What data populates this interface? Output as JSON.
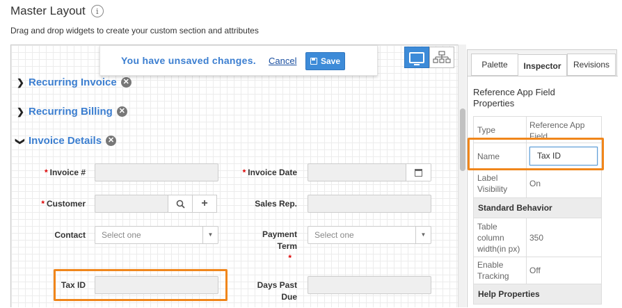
{
  "header": {
    "title": "Master Layout",
    "info_icon": "info-icon",
    "subtitle": "Drag and drop widgets to create your custom section and attributes"
  },
  "unsaved": {
    "message": "You have unsaved changes.",
    "cancel_label": "Cancel",
    "save_label": "Save"
  },
  "view_toggle": {
    "desktop_icon": "monitor-icon",
    "tree_icon": "sitemap-icon"
  },
  "sections": [
    {
      "label": "Recurring Invoice",
      "expanded": false
    },
    {
      "label": "Recurring Billing",
      "expanded": false
    },
    {
      "label": "Invoice Details",
      "expanded": true
    }
  ],
  "form": {
    "invoice_no": {
      "label": "Invoice #",
      "required": true
    },
    "invoice_date": {
      "label": "Invoice Date",
      "required": true
    },
    "customer": {
      "label": "Customer",
      "required": true
    },
    "sales_rep": {
      "label": "Sales Rep.",
      "required": false
    },
    "contact": {
      "label": "Contact",
      "required": false,
      "placeholder": "Select one"
    },
    "payment_term": {
      "label_line1": "Payment",
      "label_line2": "Term",
      "required": true,
      "placeholder": "Select one"
    },
    "tax_id": {
      "label": "Tax ID",
      "required": false
    },
    "days_past_due": {
      "label_line1": "Days Past",
      "label_line2": "Due",
      "required": false
    }
  },
  "panel": {
    "tabs": [
      "Palette",
      "Inspector",
      "Revisions"
    ],
    "active_tab": "Inspector",
    "title": "Reference App Field Properties",
    "rows": [
      {
        "key": "Type",
        "value": "Reference App Field"
      },
      {
        "key": "Name",
        "value": "Tax ID"
      },
      {
        "key": "Label Visibility",
        "value": "On"
      }
    ],
    "standard_behavior": "Standard Behavior",
    "behavior_rows": [
      {
        "key": "Table column width(in px)",
        "value": "350"
      },
      {
        "key": "Enable Tracking",
        "value": "Off"
      }
    ],
    "help_properties": "Help Properties"
  },
  "colors": {
    "accent": "#3b7ed0",
    "button": "#3d8bd8",
    "highlight": "#f0861b",
    "required": "#dd0000"
  }
}
